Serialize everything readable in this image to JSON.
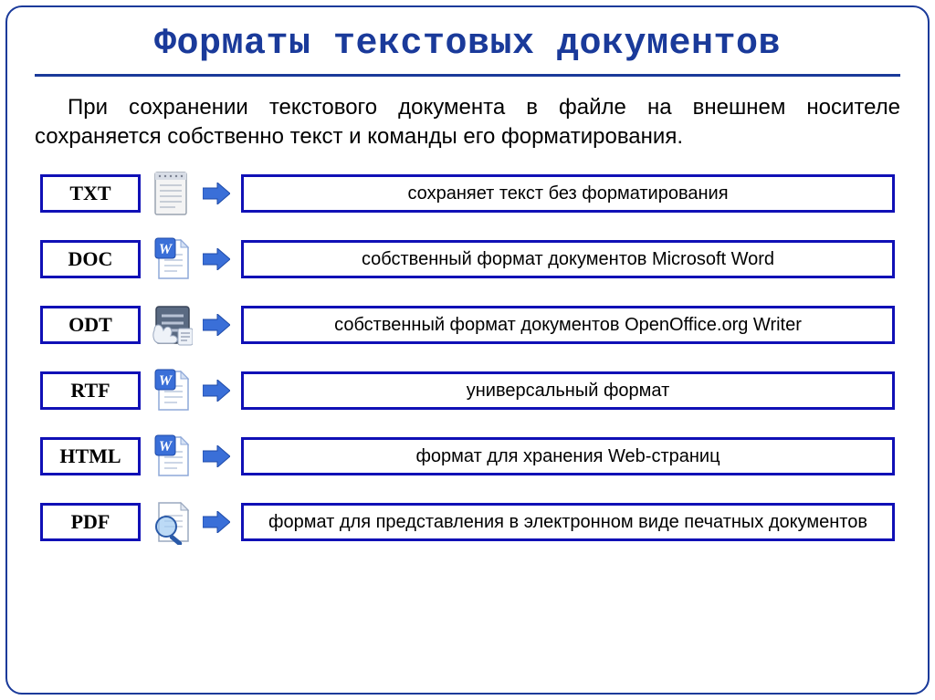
{
  "title": "Форматы текстовых документов",
  "intro": "При сохранении текстового документа в файле на внешнем носителе сохраняется собственно текст и команды его форматирования.",
  "formats": [
    {
      "ext": "TXT",
      "icon": "notepad-file-icon",
      "desc": "сохраняет текст без форматирования"
    },
    {
      "ext": "DOC",
      "icon": "word-file-icon",
      "desc": "собственный формат документов Microsoft Word"
    },
    {
      "ext": "ODT",
      "icon": "openoffice-file-icon",
      "desc": "собственный формат документов OpenOffice.org Writer"
    },
    {
      "ext": "RTF",
      "icon": "word-file-icon",
      "desc": "универсальный формат"
    },
    {
      "ext": "HTML",
      "icon": "word-file-icon",
      "desc": "формат для хранения Web-страниц"
    },
    {
      "ext": "PDF",
      "icon": "magnifier-file-icon",
      "desc": "формат для представления в электронном виде печатных документов"
    }
  ]
}
